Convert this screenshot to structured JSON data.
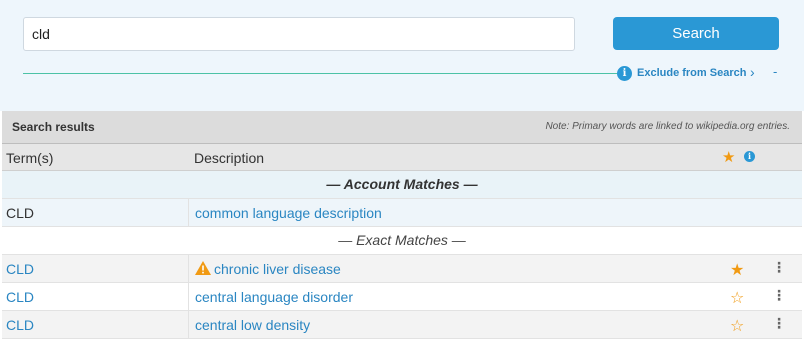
{
  "search": {
    "value": "cld",
    "button_label": "Search",
    "exclude_label": "Exclude from Search",
    "info_glyph": "i",
    "chevron_glyph": "›",
    "collapse_glyph": "-"
  },
  "results": {
    "title": "Search results",
    "note": "Note: Primary words are linked to wikipedia.org entries."
  },
  "table": {
    "headers": {
      "term": "Term(s)",
      "description": "Description"
    },
    "header_icons": [
      "star-icon",
      "info-icon"
    ],
    "groups": [
      {
        "label": "— Account Matches —",
        "rows": [
          {
            "term": "CLD",
            "description": "common language description",
            "warning": false,
            "starred": null
          }
        ]
      },
      {
        "label": "— Exact Matches —",
        "rows": [
          {
            "term": "CLD",
            "description": "chronic liver disease",
            "warning": true,
            "starred": true
          },
          {
            "term": "CLD",
            "description": "central language disorder",
            "warning": false,
            "starred": false
          },
          {
            "term": "CLD",
            "description": "central low density",
            "warning": false,
            "starred": false
          }
        ]
      }
    ]
  },
  "colors": {
    "accent": "#2a98d5",
    "star": "#f19a13",
    "link": "#2a86c2",
    "divider": "#4cc2a6"
  }
}
